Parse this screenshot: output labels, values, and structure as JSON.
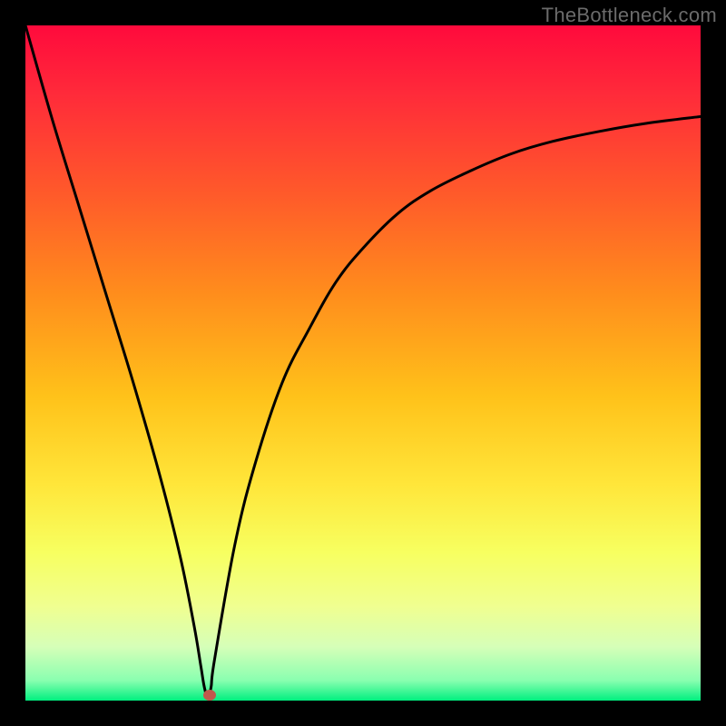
{
  "watermark": "TheBottleneck.com",
  "colors": {
    "frame": "#000000",
    "curve_stroke": "#000000",
    "marker_fill": "#c1594c"
  },
  "chart_data": {
    "type": "line",
    "title": "",
    "xlabel": "",
    "ylabel": "",
    "xlim": [
      0,
      100
    ],
    "ylim": [
      0,
      100
    ],
    "grid": false,
    "legend": false,
    "series": [
      {
        "name": "bottleneck-curve",
        "x": [
          0,
          4,
          8,
          12,
          16,
          20,
          23,
          25,
          26,
          26.5,
          27,
          27.5,
          28,
          31,
          34,
          38,
          42,
          46,
          50,
          55,
          60,
          66,
          72,
          78,
          85,
          92,
          100
        ],
        "values": [
          100,
          86,
          73,
          60,
          47,
          33,
          21,
          11,
          5,
          2,
          0.5,
          2,
          6,
          23,
          35,
          47,
          55,
          62,
          67,
          72,
          75.5,
          78.5,
          81,
          82.8,
          84.3,
          85.5,
          86.5
        ]
      }
    ],
    "markers": [
      {
        "name": "min-point",
        "x": 27.3,
        "y": 0.8
      }
    ]
  }
}
